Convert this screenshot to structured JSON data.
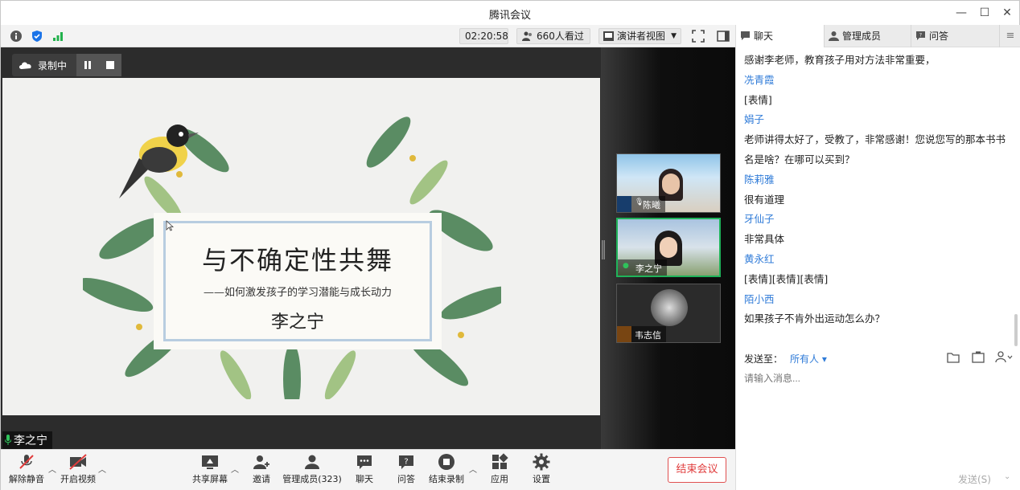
{
  "window": {
    "title": "腾讯会议"
  },
  "topbar": {
    "timer": "02:20:58",
    "viewers": "660人看过",
    "view_mode": "演讲者视图"
  },
  "recording": {
    "label": "录制中"
  },
  "slide": {
    "title": "与不确定性共舞",
    "subtitle": "——如何激发孩子的学习潜能与成长动力",
    "author": "李之宁"
  },
  "speaker_label": "李之宁",
  "thumbnails": [
    {
      "name": "陈曦"
    },
    {
      "name": "李之宁"
    },
    {
      "name": "韦志信"
    }
  ],
  "toolbar": {
    "unmute": "解除静音",
    "video": "开启视频",
    "share": "共享屏幕",
    "invite": "邀请",
    "members": "管理成员(323)",
    "chat": "聊天",
    "qa": "问答",
    "stop_record": "结束录制",
    "apps": "应用",
    "settings": "设置",
    "end_meeting": "结束会议"
  },
  "chat": {
    "tabs": [
      "聊天",
      "管理成员",
      "问答"
    ],
    "messages": [
      {
        "type": "text",
        "text": "感谢李老师，教育孩子用对方法非常重要，"
      },
      {
        "type": "name",
        "text": "冼青霞"
      },
      {
        "type": "text",
        "text": "[表情]"
      },
      {
        "type": "name",
        "text": "娟子"
      },
      {
        "type": "text",
        "text": "老师讲得太好了，受教了，非常感谢！您说您写的那本书书名是啥？在哪可以买到？"
      },
      {
        "type": "name",
        "text": "陈莉雅"
      },
      {
        "type": "text",
        "text": "很有道理"
      },
      {
        "type": "name",
        "text": "牙仙子"
      },
      {
        "type": "text",
        "text": "非常具体"
      },
      {
        "type": "name",
        "text": "黄永红"
      },
      {
        "type": "text",
        "text": "[表情][表情][表情]"
      },
      {
        "type": "name",
        "text": "陌小西"
      },
      {
        "type": "text",
        "text": "如果孩子不肯外出运动怎么办？"
      }
    ],
    "send_to_label": "发送至：",
    "send_to_value": "所有人",
    "input_placeholder": "请输入消息...",
    "send_button": "发送(S)"
  },
  "colors": {
    "accent": "#2f7bd8",
    "end_red": "#e03c3c",
    "active_green": "#1fb35a"
  }
}
